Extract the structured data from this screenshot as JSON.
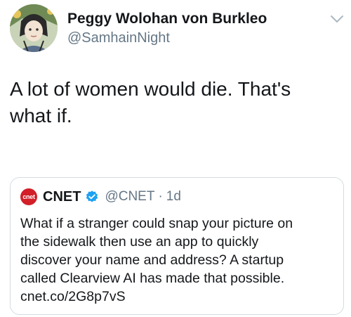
{
  "tweet": {
    "author_name": "Peggy Wolohan von Burkleo",
    "author_handle": "@SamhainNight",
    "text_lines": [
      "A lot of women would die. That's",
      "what if."
    ]
  },
  "quoted": {
    "logo_text": "cnet",
    "name": "CNET",
    "handle": "@CNET",
    "separator": "·",
    "time": "1d",
    "text_lines": [
      "What if a stranger could snap your picture on",
      "the sidewalk then use an app to quickly",
      "discover your name and address? A startup",
      "called Clearview AI has made that possible.",
      "cnet.co/2G8p7vS"
    ]
  },
  "colors": {
    "name": "#14171a",
    "muted": "#657786",
    "verified": "#1da1f2",
    "cnet_red": "#d21f28",
    "card_border": "#d4dbe0"
  },
  "icons": {
    "avatar": "illustrated-avatar",
    "menu": "chevron-down-icon",
    "verified": "verified-badge-icon",
    "logo": "cnet-logo"
  }
}
